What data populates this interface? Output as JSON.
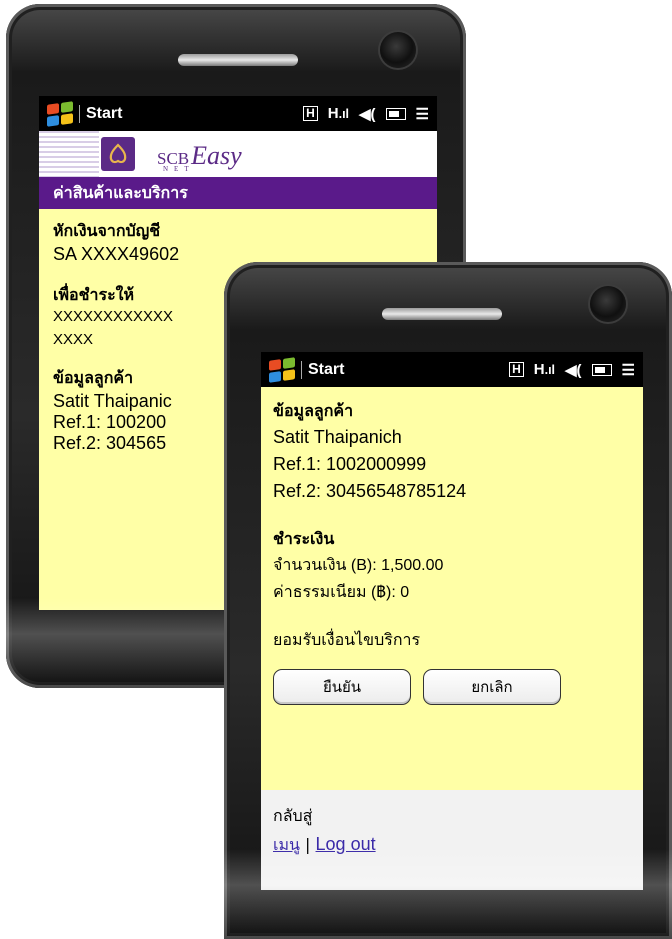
{
  "back_phone": {
    "status": {
      "start_label": "Start"
    },
    "brand": {
      "prefix": "SCB",
      "name": "Easy",
      "sub": "NET"
    },
    "title": "ค่าสินค้าและบริการ",
    "debit_label": "หักเงินจากบัญชี",
    "debit_account": "SA XXXX49602",
    "pay_to_label": "เพื่อชำระให้",
    "pay_to_line1": "XXXXXXXXXXXX",
    "pay_to_line2": "XXXX",
    "customer_label": "ข้อมูลลูกค้า",
    "customer_name": "Satit Thaipanic",
    "ref1": "Ref.1: 100200",
    "ref2": "Ref.2: 304565"
  },
  "front_phone": {
    "status": {
      "start_label": "Start"
    },
    "customer_label": "ข้อมูลลูกค้า",
    "customer_name": "Satit Thaipanich",
    "ref1": "Ref.1: 1002000999",
    "ref2": "Ref.2: 30456548785124",
    "payment_label": "ชำระเงิน",
    "amount": "จำนวนเงิน (B): 1,500.00",
    "fee": "ค่าธรรมเนียม (฿): 0",
    "terms": "ยอมรับเงื่อนไขบริการ",
    "confirm_button": "ยืนยัน",
    "cancel_button": "ยกเลิก",
    "back_to": "กลับสู่",
    "menu_link": "เมนู",
    "separator": "|",
    "logout_link": "Log out"
  },
  "colors": {
    "accent_purple": "#5a1a8a",
    "screen_yellow": "#ffffa6",
    "link_blue": "#3a2aa8"
  },
  "icons": [
    "windows-flag-icon",
    "h-icon",
    "signal-icon",
    "speaker-icon",
    "battery-icon",
    "menu-icon"
  ]
}
